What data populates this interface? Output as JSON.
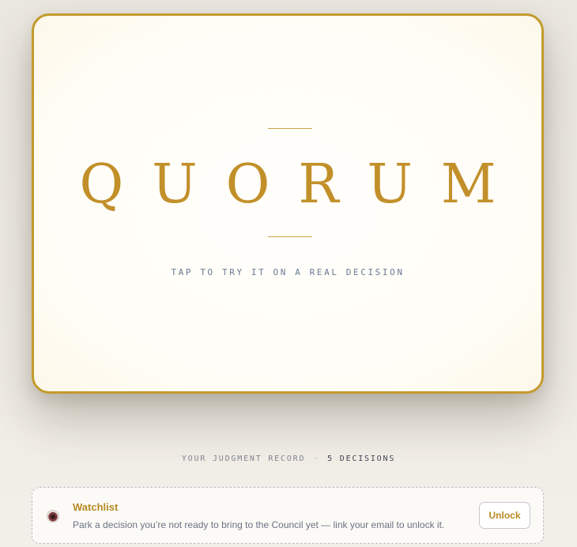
{
  "hero": {
    "wordmark": "QUORUM",
    "cta": "TAP TO TRY IT ON A REAL DECISION"
  },
  "record": {
    "label": "YOUR JUDGMENT RECORD",
    "separator": "·",
    "count": "5 DECISIONS"
  },
  "watchlist": {
    "icon": "eye-icon",
    "title": "Watchlist",
    "description": "Park a decision you’re not ready to bring to the Council yet — link your email to unlock it.",
    "button_label": "Unlock"
  },
  "colors": {
    "gold": "#c2902a",
    "card_border": "#c49a2e",
    "muted_blue": "#6b7a93"
  }
}
